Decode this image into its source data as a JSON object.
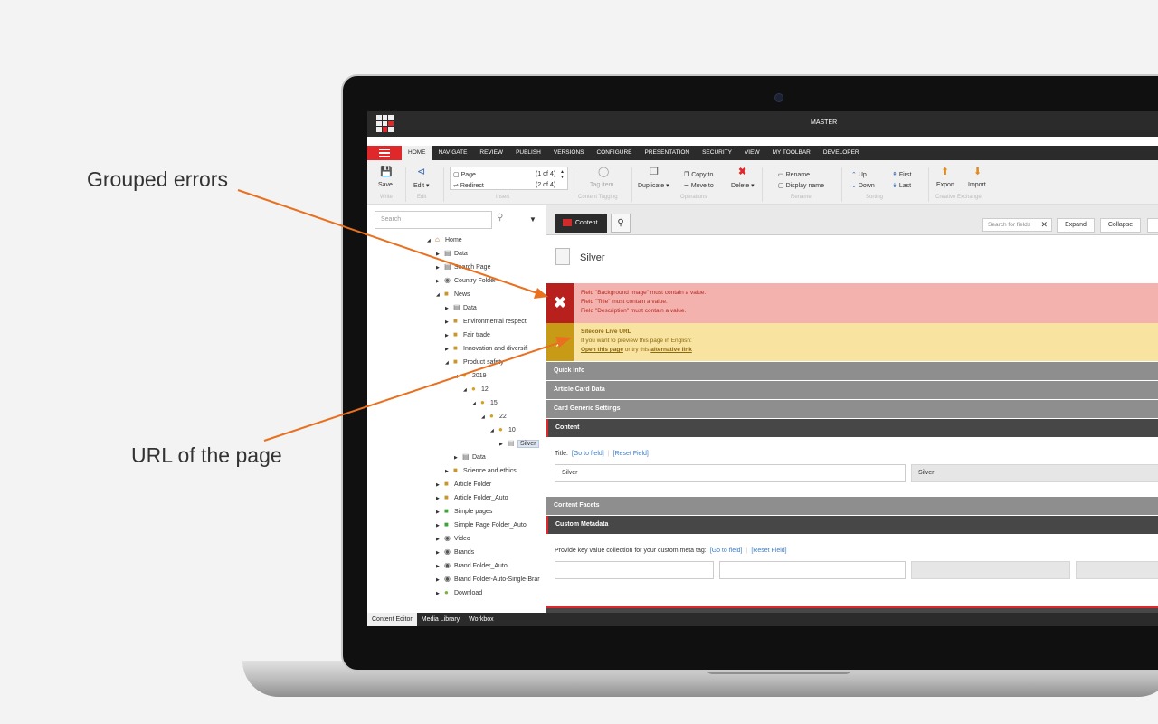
{
  "callouts": {
    "grouped_errors": "Grouped errors",
    "url_of_page": "URL of the page"
  },
  "app": {
    "database": "MASTER",
    "colors": {
      "accent": "#e0282a",
      "error_bg": "#f4b2ae",
      "warn_bg": "#f9e3a0",
      "link": "#3b7cc5"
    }
  },
  "menu_tabs": [
    "HOME",
    "NAVIGATE",
    "REVIEW",
    "PUBLISH",
    "VERSIONS",
    "CONFIGURE",
    "PRESENTATION",
    "SECURITY",
    "VIEW",
    "MY TOOLBAR",
    "DEVELOPER"
  ],
  "ribbon": {
    "save": "Save",
    "edit": "Edit",
    "insert_page": "Page",
    "insert_page_count": "(1 of 4)",
    "insert_redirect": "Redirect",
    "insert_redirect_count": "(2 of 4)",
    "tag_item": "Tag item",
    "duplicate": "Duplicate",
    "copy_to": "Copy to",
    "move_to": "Move to",
    "delete": "Delete",
    "rename": "Rename",
    "display_name": "Display name",
    "up": "Up",
    "down": "Down",
    "first": "First",
    "last": "Last",
    "export": "Export",
    "import": "Import",
    "groups": {
      "write": "Write",
      "edit": "Edit",
      "insert": "Insert",
      "content_tagging": "Content Tagging",
      "operations": "Operations",
      "rename": "Rename",
      "sorting": "Sorting",
      "creative_exchange": "Creative Exchange"
    }
  },
  "tree": {
    "search_placeholder": "Search",
    "items": [
      "Home",
      "Data",
      "Search Page",
      "Country Folder",
      "News",
      "Data",
      "Environmental respect",
      "Fair trade",
      "Innovation and diversifi",
      "Product safety",
      "2019",
      "12",
      "15",
      "22",
      "10",
      "Silver",
      "Data",
      "Science and ethics",
      "Article Folder",
      "Article Folder_Auto",
      "Simple pages",
      "Simple Page Folder_Auto",
      "Video",
      "Brands",
      "Brand Folder_Auto",
      "Brand Folder-Auto-Single-Brar",
      "Download"
    ]
  },
  "bottom_tabs": [
    "Content Editor",
    "Media Library",
    "Workbox"
  ],
  "editor": {
    "content_tab": "Content",
    "search_fields": "Search for fields",
    "expand": "Expand",
    "collapse": "Collapse",
    "item_title": "Silver",
    "errors": [
      "Field \"Background Image\" must contain a value.",
      "Field \"Title\" must contain a value.",
      "Field \"Description\" must contain a value."
    ],
    "live_url": {
      "title": "Sitecore Live URL",
      "line1": "If you want to preview this page in English:",
      "open_link": "Open this page",
      "middle": " or try this ",
      "alt_link": "alternative link"
    },
    "sections": {
      "quick_info": "Quick Info",
      "article_card": "Article Card Data",
      "card_generic": "Card Generic Settings",
      "content": "Content",
      "content_facets": "Content Facets",
      "custom_metadata": "Custom Metadata"
    },
    "title_field": {
      "label": "Title:",
      "goto": "[Go to field]",
      "reset": "[Reset Field]",
      "value": "Silver",
      "standard_value": "Silver"
    },
    "meta_field": {
      "label": "Provide key value collection for your custom meta tag:",
      "goto": "[Go to field]",
      "reset": "[Reset Field]"
    }
  }
}
